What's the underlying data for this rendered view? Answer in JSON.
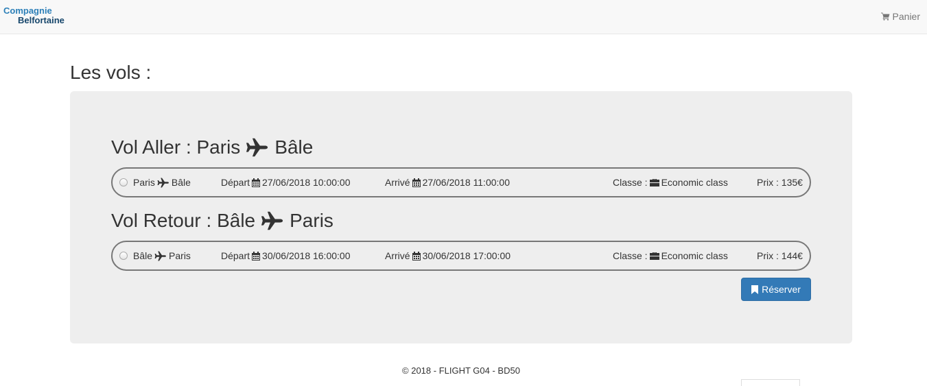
{
  "header": {
    "logo_line1": "Compagnie",
    "logo_line2": "Belfortaine",
    "cart_label": "Panier"
  },
  "page_title": "Les vols :",
  "outbound": {
    "title_from": "Vol Aller : Paris",
    "title_to": "Bâle",
    "row": {
      "from": "Paris",
      "to": "Bâle",
      "depart_label": "Départ",
      "depart_value": "27/06/2018 10:00:00",
      "arrive_label": "Arrivé",
      "arrive_value": "27/06/2018 11:00:00",
      "class_label": "Classe :",
      "class_value": "Economic class",
      "price": "Prix : 135€"
    }
  },
  "return": {
    "title_from": "Vol Retour : Bâle",
    "title_to": "Paris",
    "row": {
      "from": "Bâle",
      "to": "Paris",
      "depart_label": "Départ",
      "depart_value": "30/06/2018 16:00:00",
      "arrive_label": "Arrivé",
      "arrive_value": "30/06/2018 17:00:00",
      "class_label": "Classe :",
      "class_value": "Economic class",
      "price": "Prix : 144€"
    }
  },
  "reserve_button": "Réserver",
  "footer": "© 2018 - FLIGHT G04 - BD50",
  "icons": {
    "cart": "shopping-cart-icon",
    "plane": "plane-icon",
    "calendar": "calendar-icon",
    "briefcase": "briefcase-icon",
    "bookmark": "bookmark-icon"
  },
  "colors": {
    "primary_button": "#337ab7",
    "panel_background": "#eeeeee",
    "logo_blue": "#2b7fb8",
    "logo_dark": "#16466b"
  }
}
